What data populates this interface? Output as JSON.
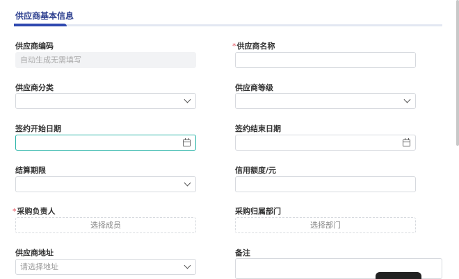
{
  "section": {
    "title": "供应商基本信息"
  },
  "fields": {
    "supplier_code": {
      "label": "供应商编码",
      "placeholder": "自动生成无需填写"
    },
    "supplier_name": {
      "label": "供应商名称",
      "required_mark": "*"
    },
    "supplier_category": {
      "label": "供应商分类"
    },
    "supplier_level": {
      "label": "供应商等级"
    },
    "contract_start": {
      "label": "签约开始日期"
    },
    "contract_end": {
      "label": "签约结束日期"
    },
    "settlement_period": {
      "label": "结算期限"
    },
    "credit_limit": {
      "label": "信用额度/元"
    },
    "purchaser": {
      "label": "采购负责人",
      "required_mark": "*",
      "button_text": "选择成员"
    },
    "purchase_department": {
      "label": "采购归属部门",
      "button_text": "选择部门"
    },
    "supplier_address": {
      "label": "供应商地址",
      "placeholder": "请选择地址"
    },
    "remark": {
      "label": "备注"
    }
  }
}
